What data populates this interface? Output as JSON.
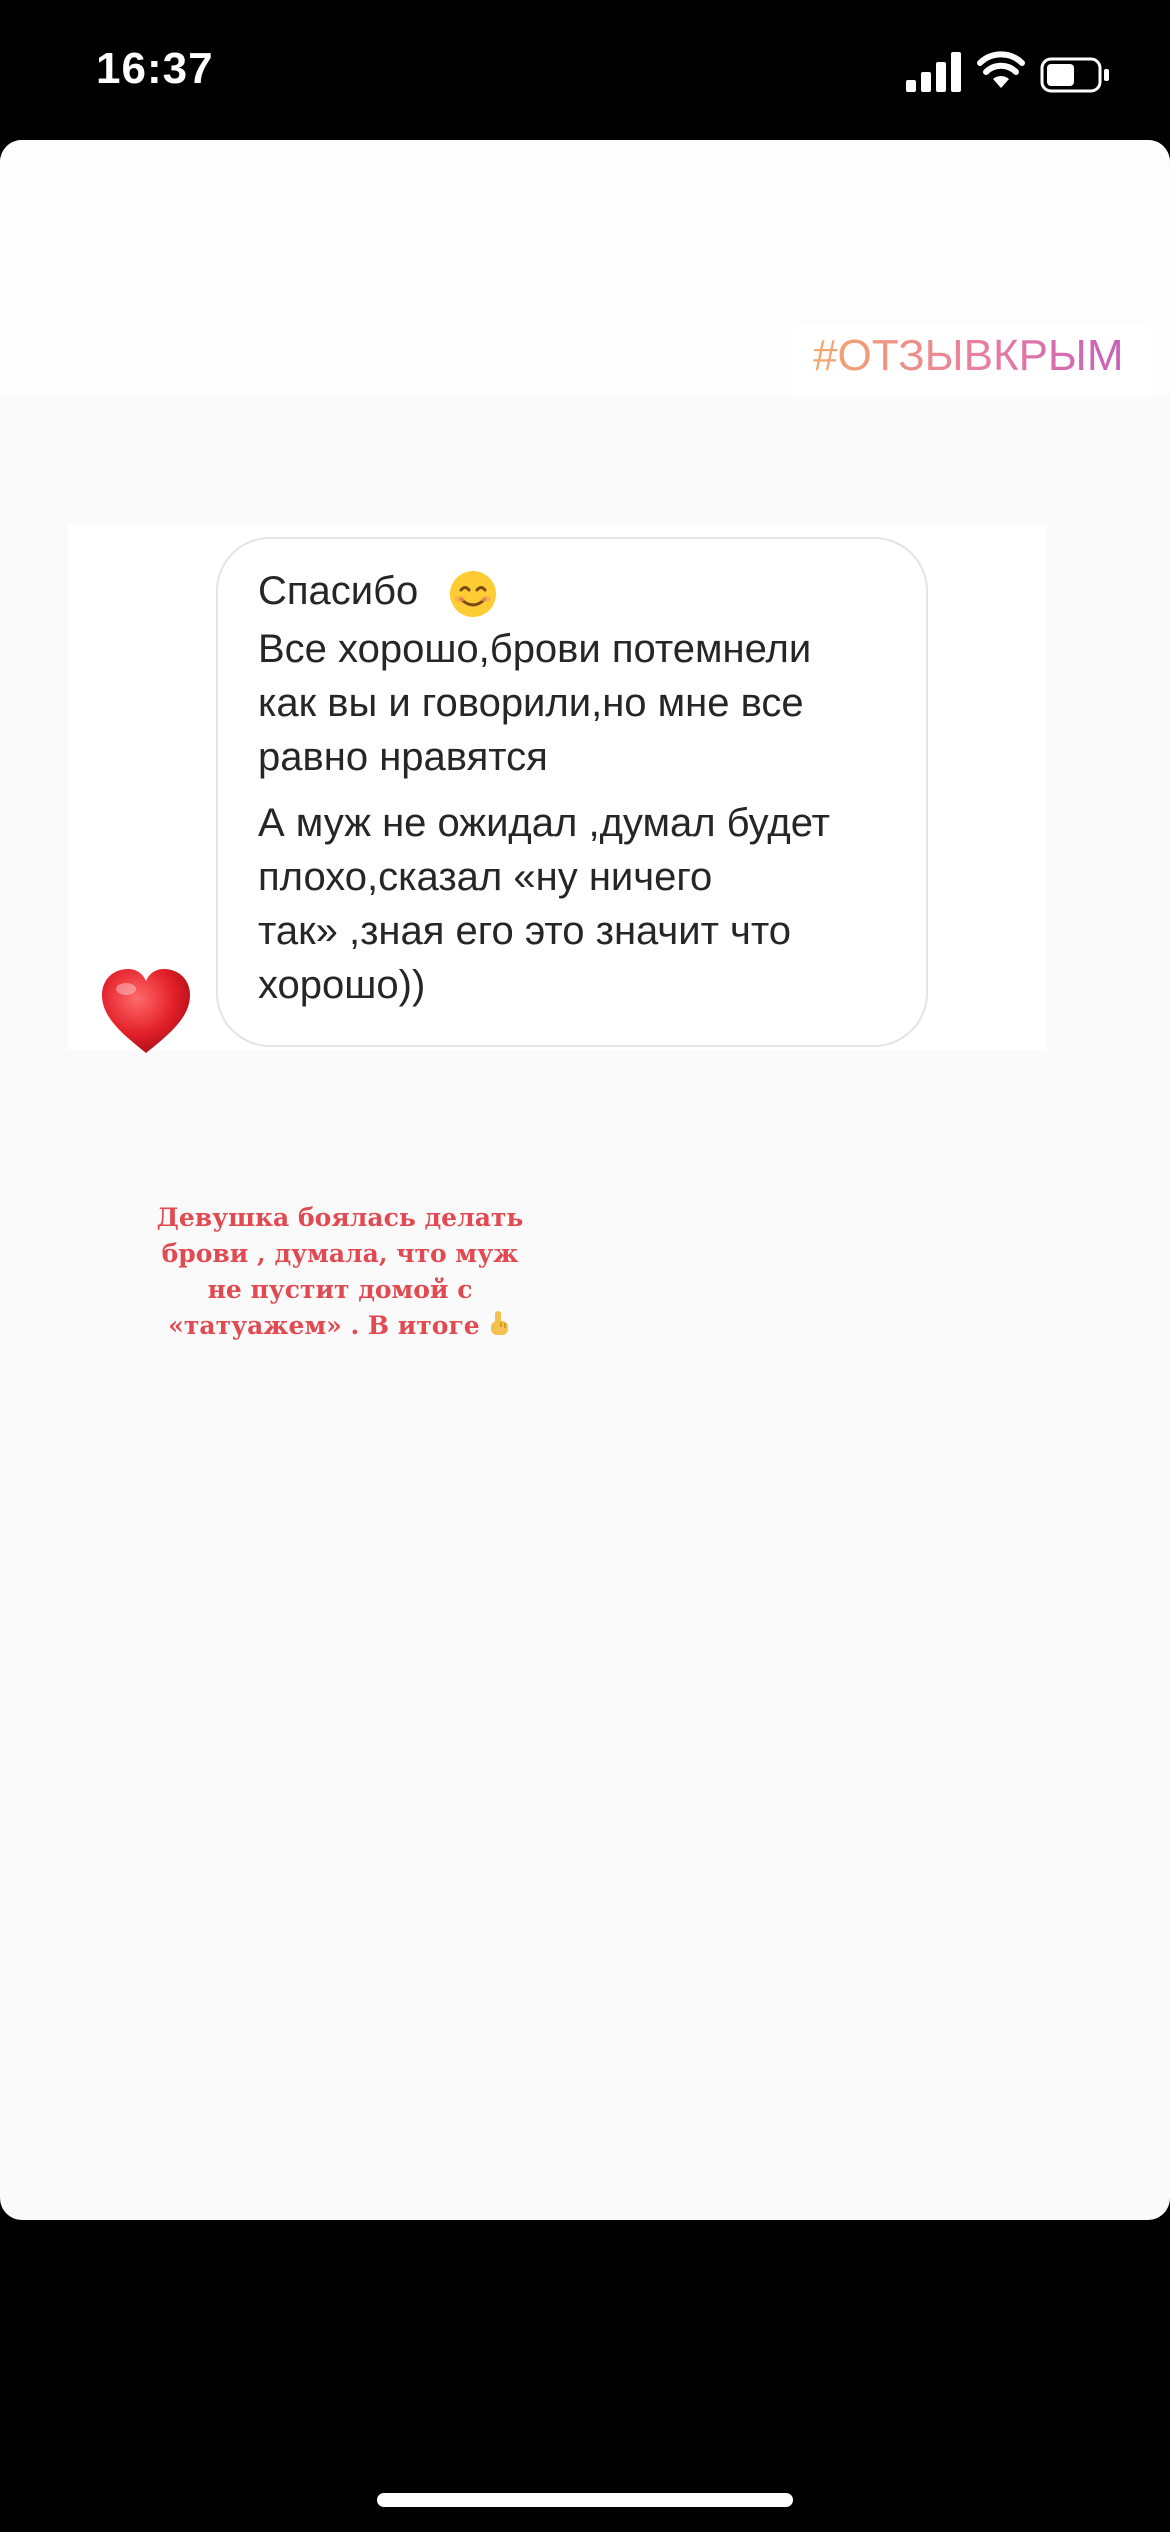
{
  "status_bar": {
    "time": "16:37",
    "icons": [
      "cellular-signal-icon",
      "wifi-icon",
      "battery-icon"
    ]
  },
  "story": {
    "hashtag": "#ОТЗЫВКРЫМ",
    "hashtag_colors": [
      "#f3a86b",
      "#e67aa4",
      "#c85fb7"
    ],
    "message": {
      "lines": [
        "Спасибо",
        "Все хорошо,брови потемнели",
        "как вы и говорили,но мне все",
        "равно нравятся",
        "А муж не ожидал ,думал будет",
        "плохо,сказал «ну ничего",
        "так» ,зная его это значит что",
        "хорошо))"
      ],
      "emoji": "smiling-face-icon",
      "reaction": "red-heart-icon"
    },
    "caption": {
      "lines": [
        "Девушка боялась делать",
        "брови , думала, что муж",
        "не пустит домой с",
        "«татуажем» . В итоге"
      ],
      "trailing_icon": "pointing-up-hand-icon",
      "color": "#e24a52"
    }
  }
}
